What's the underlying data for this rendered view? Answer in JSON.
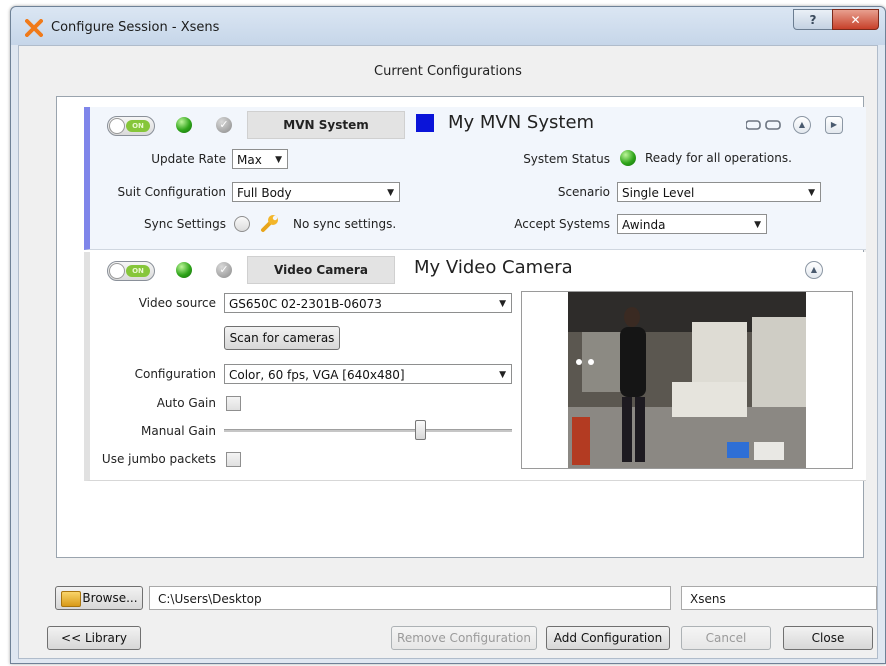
{
  "window": {
    "title": "Configure Session - Xsens",
    "help_glyph": "?",
    "close_glyph": "✕"
  },
  "section_title": "Current Configurations",
  "mvn": {
    "toggle_label": "ON",
    "check_glyph": "✓",
    "tab_label": "MVN System",
    "name": "My MVN System",
    "color_swatch": "#0a14d9",
    "update_rate_label": "Update Rate",
    "update_rate_value": "Max",
    "suit_config_label": "Suit Configuration",
    "suit_config_value": "Full Body",
    "sync_label": "Sync Settings",
    "sync_text": "No sync settings.",
    "system_status_label": "System Status",
    "system_status_text": "Ready for all operations.",
    "scenario_label": "Scenario",
    "scenario_value": "Single Level",
    "accept_label": "Accept Systems",
    "accept_value": "Awinda"
  },
  "video": {
    "toggle_label": "ON",
    "check_glyph": "✓",
    "tab_label": "Video Camera",
    "name": "My Video Camera",
    "source_label": "Video source",
    "source_value": "GS650C 02-2301B-06073",
    "scan_button": "Scan for cameras",
    "config_label": "Configuration",
    "config_value": "Color, 60 fps, VGA [640x480]",
    "auto_gain_label": "Auto Gain",
    "manual_gain_label": "Manual Gain",
    "manual_gain_level": 0.68,
    "jumbo_label": "Use jumbo packets"
  },
  "footer": {
    "browse_button": "Browse...",
    "path_value": "C:\\Users\\Desktop",
    "name_value": "Xsens",
    "library_button": "<< Library",
    "remove_button": "Remove Configuration",
    "add_button": "Add Configuration",
    "cancel_button": "Cancel",
    "close_button": "Close"
  },
  "colors": {
    "mvn_accent": "#7f86ea",
    "status_green": "#2fa51a",
    "swatch": "#0a14d9"
  }
}
